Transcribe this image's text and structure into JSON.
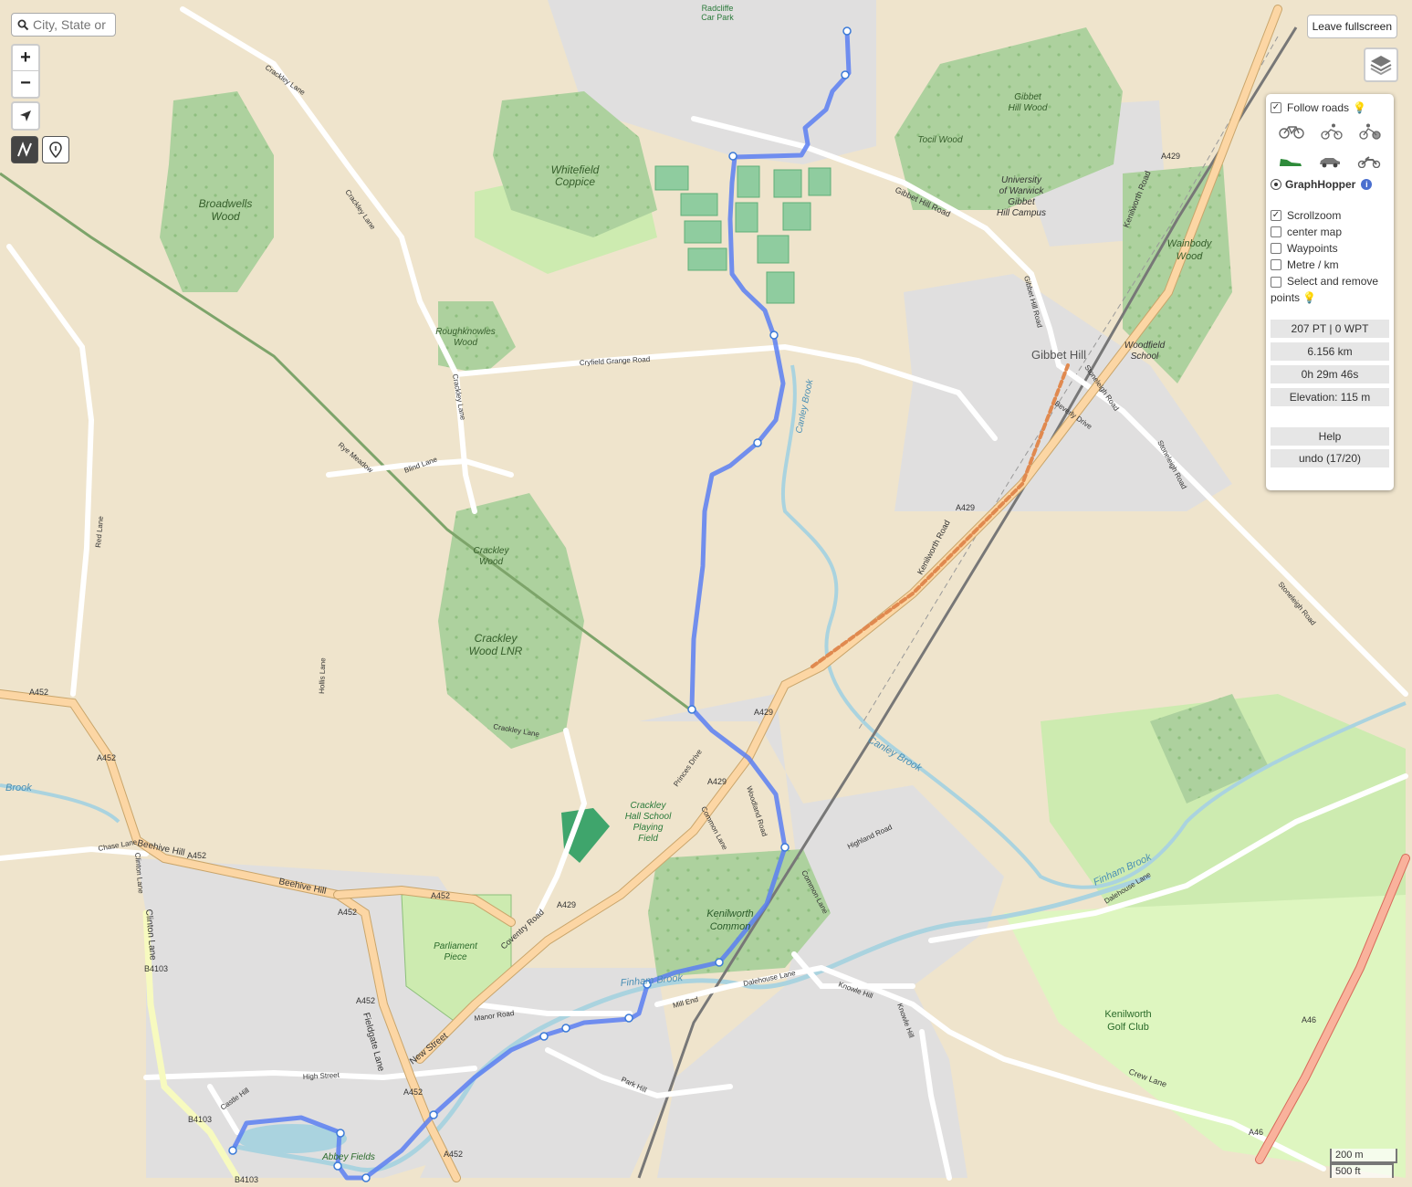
{
  "search": {
    "placeholder": "City, State or"
  },
  "zoom": {
    "in_label": "+",
    "out_label": "−"
  },
  "controls": {
    "leave_fullscreen": "Leave fullscreen"
  },
  "panel": {
    "follow_roads": "Follow roads",
    "router_name": "GraphHopper",
    "scrollzoom": "Scrollzoom",
    "center_map": "center map",
    "waypoints": "Waypoints",
    "metre_km": "Metre / km",
    "select_remove": "Select and remove points",
    "stats": {
      "points": "207 PT | 0 WPT",
      "distance": "6.156 km",
      "time": "0h 29m 46s",
      "elevation": "Elevation: 115 m"
    },
    "help": "Help",
    "undo": "undo (17/20)"
  },
  "scale": {
    "metric": "200 m",
    "imperial": "500 ft"
  },
  "map_labels": {
    "radcliffe": "Radcliffe",
    "radcliffe2": "Car Park",
    "crackley_lane": "Crackley Lane",
    "whitefield1": "Whitefield",
    "whitefield2": "Coppice",
    "broadwells1": "Broadwells",
    "broadwells2": "Wood",
    "gibbet_hill_wood1": "Gibbet",
    "gibbet_hill_wood2": "Hill Wood",
    "tocil": "Tocil Wood",
    "uow1": "University",
    "uow2": "of Warwick",
    "uow3": "Gibbet",
    "uow4": "Hill Campus",
    "gibbet_hill_road": "Gibbet Hill Road",
    "kenilworth_road": "Kenilworth Road",
    "wainbody1": "Wainbody",
    "wainbody2": "Wood",
    "roughknowles1": "Roughknowles",
    "roughknowles2": "Wood",
    "cryfield": "Cryfield Grange Road",
    "gibbet_hill": "Gibbet Hill",
    "woodfield1": "Woodfield",
    "woodfield2": "School",
    "stoneleigh_road": "Stoneleigh Road",
    "beverly": "Beverly Drive",
    "canley_brook": "Canley Brook",
    "rye_meadow": "Rye Meadow",
    "blind_lane": "Blind Lane",
    "red_lane": "Red Lane",
    "crackley_wood1": "Crackley",
    "crackley_wood2": "Wood",
    "crackley_lnr1": "Crackley",
    "crackley_lnr2": "Wood LNR",
    "hollis": "Hollis Lane",
    "a452": "A452",
    "a429": "A429",
    "a46": "A46",
    "b4103": "B4103",
    "brook": "Brook",
    "crackley_hall1": "Crackley",
    "crackley_hall2": "Hall School",
    "crackley_hall3": "Playing",
    "crackley_hall4": "Field",
    "beehive_hill": "Beehive Hill",
    "chase_lane": "Chase Lane",
    "clinton_lane": "Clinton Lane",
    "parliament1": "Parliament",
    "parliament2": "Piece",
    "coventry_road": "Coventry Road",
    "kenilworth_common1": "Kenilworth",
    "kenilworth_common2": "Common",
    "common_lane": "Common Lane",
    "woodland_road": "Woodland Road",
    "finham_brook": "Finham Brook",
    "dalehouse_lane": "Dalehouse Lane",
    "knowle_hill": "Knowle Hill",
    "golf1": "Kenilworth",
    "golf2": "Golf Club",
    "crew_lane": "Crew Lane",
    "fieldgate_lane": "Fieldgate Lane",
    "new_street": "New Street",
    "manor_road": "Manor Road",
    "high_street": "High Street",
    "castle_hill": "Castle Hill",
    "park_hill": "Park Hill",
    "mill_end": "Mill End",
    "abbey_fields": "Abbey Fields",
    "highland_road": "Highland Road",
    "princes_drive": "Princes Drive",
    "stoneleigh_road2": "Stoneleigh Road"
  },
  "colors": {
    "route": "#5b7ff2",
    "forest": "#add19e",
    "residential": "#e0dfdf",
    "farmland": "#eee0c8",
    "primary_road": "#fcd6a4",
    "trunk": "#f9b29c"
  }
}
